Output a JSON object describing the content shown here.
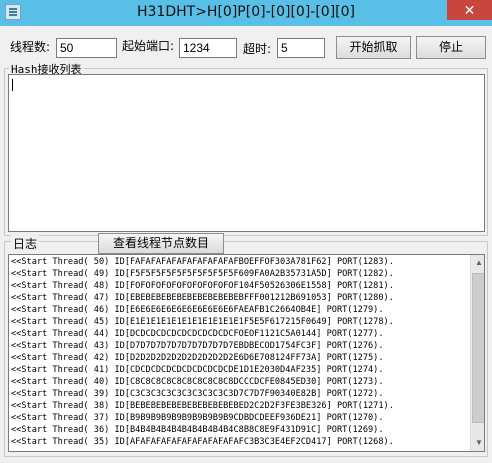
{
  "window": {
    "title": "H31DHT>H[0]P[0]-[0][0]-[0][0]",
    "close_glyph": "✕"
  },
  "controls": {
    "threads_label": "线程数:",
    "threads_value": "50",
    "start_port_label": "起始端口:",
    "start_port_value": "1234",
    "timeout_label": "超时:",
    "timeout_value": "5",
    "start_button": "开始抓取",
    "stop_button": "停止"
  },
  "hash_group": {
    "caption": "Hash接收列表"
  },
  "log_group": {
    "caption": "日志",
    "count_button": "查看线程节点数目",
    "lines": [
      "<<Start Thread( 50) ID[FAFAFAFAFAFAFAFAFAFAFBOEFFOF303A781F62] PORT(1283).",
      "<<Start Thread( 49) ID[F5F5F5F5F5F5F5F5F5F5F609FA0A2B35731A5D] PORT(1282).",
      "<<Start Thread( 48) ID[FOFOFOFOFOFOFOFOFOFOF104F50526306E1558] PORT(1281).",
      "<<Start Thread( 47) ID[EBEBEBEBEBEBEBEBEBEBEBFFF001212B691053] PORT(1280).",
      "<<Start Thread( 46) ID[E6E6E6E6E6E6E6E6E6E6FAEAFB1C2664OB4E] PORT(1279).",
      "<<Start Thread( 45) ID[E1E1E1E1E1E1E1E1E1E1E1F5E5F617215F0649] PORT(1278).",
      "<<Start Thread( 44) ID[DCDCDCDCDCDCDCDCDCDCFOEOF1121C5A0144] PORT(1277).",
      "<<Start Thread( 43) ID[D7D7D7D7D7D7D7D7D7D7EBDBECOD1754FC3F] PORT(1276).",
      "<<Start Thread( 42) ID[D2D2D2D2D2D2D2D2D2D2E6D6E708124FF73A] PORT(1275).",
      "<<Start Thread( 41) ID[CDCDCDCDCDCDCDCDCDCDE1D1E2030D4AF235] PORT(1274).",
      "<<Start Thread( 40) ID[C8C8C8C8C8C8C8C8C8C8DCCCDCFE0845ED30] PORT(1273).",
      "<<Start Thread( 39) ID[C3C3C3C3C3C3C3C3C3C3D7C7D7F90340E82B] PORT(1272).",
      "<<Start Thread( 38) ID[BEBEBEBEBEBEBEBEBEBEBED2C2D2F3FE3BE326] PORT(1271).",
      "<<Start Thread( 37) ID[B9B9B9B9B9B9B9B9B9B9CDBDCDEEF936DE21] PORT(1270).",
      "<<Start Thread( 36) ID[B4B4B4B4B4B4B4B4B4B4C8B8C8E9F431D91C] PORT(1269).",
      "<<Start Thread( 35) ID[AFAFAFAFAFAFAFAFAFAFAFC3B3C3E4EF2CD417] PORT(1268)."
    ]
  },
  "scrollbar": {
    "up_glyph": "▲",
    "down_glyph": "▼"
  }
}
